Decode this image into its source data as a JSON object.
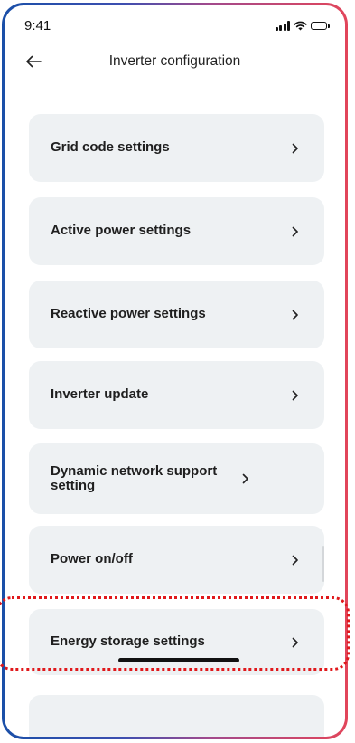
{
  "status_bar": {
    "time": "9:41"
  },
  "header": {
    "back_icon": "arrow-left-icon",
    "title": "Inverter configuration"
  },
  "menu": {
    "items": [
      {
        "label": "Grid code settings"
      },
      {
        "label": "Active power settings"
      },
      {
        "label": "Reactive power settings"
      },
      {
        "label": "Inverter update"
      },
      {
        "label": "Dynamic network support setting"
      },
      {
        "label": "Power on/off"
      },
      {
        "label": "Energy storage settings"
      }
    ]
  },
  "colors": {
    "card_background": "#eef1f3",
    "highlight_outline": "#e0181b",
    "frame_gradient_start": "#1a4fa8",
    "frame_gradient_end": "#e2455a"
  },
  "highlighted_item": "Energy storage settings"
}
